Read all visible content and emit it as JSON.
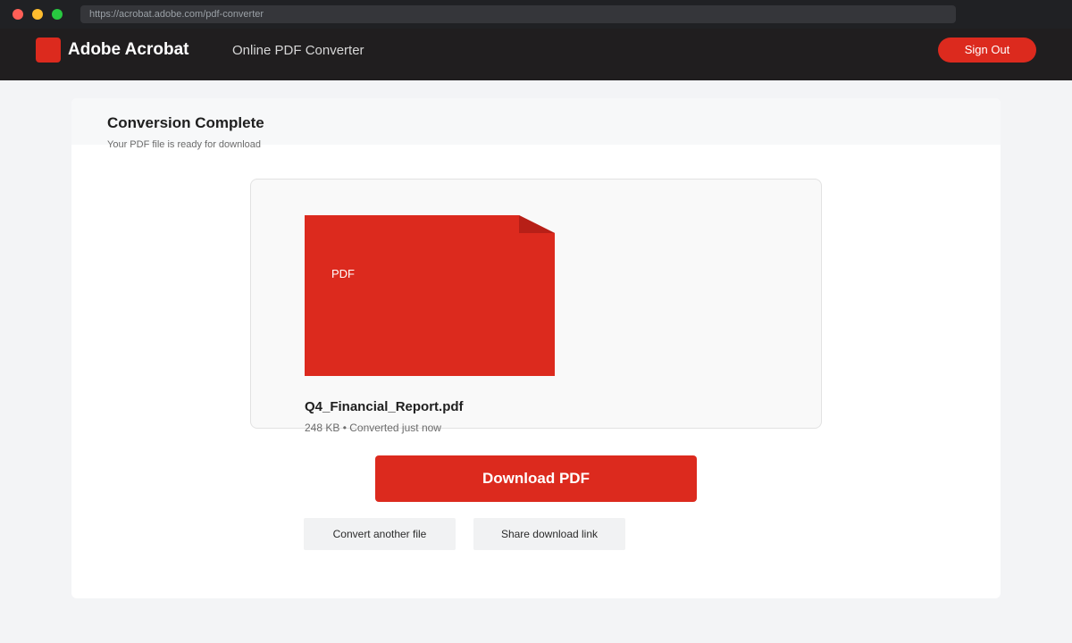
{
  "browser": {
    "url": "https://acrobat.adobe.com/pdf-converter"
  },
  "header": {
    "brand": "Adobe Acrobat",
    "nav_title": "Online PDF Converter",
    "sign_out_label": "Sign Out"
  },
  "card": {
    "title": "Conversion Complete",
    "subtitle": "Your PDF file is ready for download"
  },
  "file": {
    "icon_label": "PDF",
    "name": "Q4_Financial_Report.pdf",
    "meta": "248 KB • Converted just now"
  },
  "actions": {
    "download_label": "Download PDF",
    "convert_label": "Convert another file",
    "share_label": "Share download link"
  },
  "colors": {
    "brand_red": "#dc2a1e",
    "fold_dark": "#b71f17",
    "header_bg": "#201e1f"
  },
  "icons": {
    "logo": "adobe-logo-icon",
    "file": "pdf-document-icon"
  }
}
